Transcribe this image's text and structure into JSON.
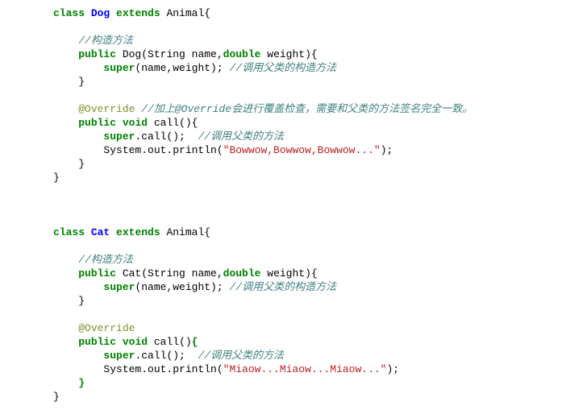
{
  "tokens": [
    {
      "cls": "kw",
      "t": "class"
    },
    {
      "t": " "
    },
    {
      "cls": "cls",
      "t": "Dog"
    },
    {
      "t": " "
    },
    {
      "cls": "kw",
      "t": "extends"
    },
    {
      "t": " Animal{\n"
    },
    {
      "t": "\n"
    },
    {
      "t": "    "
    },
    {
      "cls": "com",
      "t": "//构造方法"
    },
    {
      "t": "\n"
    },
    {
      "t": "    "
    },
    {
      "cls": "kw",
      "t": "public"
    },
    {
      "t": " Dog(String name,"
    },
    {
      "cls": "kw",
      "t": "double"
    },
    {
      "t": " weight){\n"
    },
    {
      "t": "        "
    },
    {
      "cls": "kw",
      "t": "super"
    },
    {
      "t": "(name,weight); "
    },
    {
      "cls": "com",
      "t": "//调用父类的构造方法"
    },
    {
      "t": "\n"
    },
    {
      "t": "    }\n"
    },
    {
      "t": "\n"
    },
    {
      "t": "    "
    },
    {
      "cls": "ann",
      "t": "@Override"
    },
    {
      "t": " "
    },
    {
      "cls": "com",
      "t": "//加上@Override会进行覆盖检查，需要和父类的方法签名完全一致。"
    },
    {
      "t": "\n"
    },
    {
      "t": "    "
    },
    {
      "cls": "kw",
      "t": "public"
    },
    {
      "t": " "
    },
    {
      "cls": "kw",
      "t": "void"
    },
    {
      "t": " call(){\n"
    },
    {
      "t": "        "
    },
    {
      "cls": "kw",
      "t": "super"
    },
    {
      "t": ".call();  "
    },
    {
      "cls": "com",
      "t": "//调用父类的方法"
    },
    {
      "t": "\n"
    },
    {
      "t": "        System.out.println("
    },
    {
      "cls": "str",
      "t": "\"Bowwow,Bowwow,Bowwow...\""
    },
    {
      "t": ");\n"
    },
    {
      "t": "    }\n"
    },
    {
      "t": "}\n"
    },
    {
      "t": "\n"
    },
    {
      "t": "\n"
    },
    {
      "t": "\n"
    },
    {
      "cls": "kw",
      "t": "class"
    },
    {
      "t": " "
    },
    {
      "cls": "cls",
      "t": "Cat"
    },
    {
      "t": " "
    },
    {
      "cls": "kw",
      "t": "extends"
    },
    {
      "t": " Animal{\n"
    },
    {
      "t": "\n"
    },
    {
      "t": "    "
    },
    {
      "cls": "com",
      "t": "//构造方法"
    },
    {
      "t": "\n"
    },
    {
      "t": "    "
    },
    {
      "cls": "kw",
      "t": "public"
    },
    {
      "t": " Cat(String name,"
    },
    {
      "cls": "kw",
      "t": "double"
    },
    {
      "t": " weight){\n"
    },
    {
      "t": "        "
    },
    {
      "cls": "kw",
      "t": "super"
    },
    {
      "t": "(name,weight); "
    },
    {
      "cls": "com",
      "t": "//调用父类的构造方法"
    },
    {
      "t": "\n"
    },
    {
      "t": "    }\n"
    },
    {
      "t": "\n"
    },
    {
      "t": "    "
    },
    {
      "cls": "ann",
      "t": "@Override"
    },
    {
      "t": "\n"
    },
    {
      "t": "    "
    },
    {
      "cls": "kw",
      "t": "public"
    },
    {
      "t": " "
    },
    {
      "cls": "kw",
      "t": "void"
    },
    {
      "t": " call()"
    },
    {
      "cls": "brace-hl",
      "t": "{"
    },
    {
      "t": "\n"
    },
    {
      "t": "        "
    },
    {
      "cls": "kw",
      "t": "super"
    },
    {
      "t": ".call();  "
    },
    {
      "cls": "com",
      "t": "//调用父类的方法"
    },
    {
      "t": "\n"
    },
    {
      "t": "        System.out.println("
    },
    {
      "cls": "str",
      "t": "\"Miaow...Miaow...Miaow...\""
    },
    {
      "t": ");\n"
    },
    {
      "t": "    "
    },
    {
      "cls": "brace-hl",
      "t": "}"
    },
    {
      "t": "\n"
    },
    {
      "t": "}\n"
    }
  ]
}
